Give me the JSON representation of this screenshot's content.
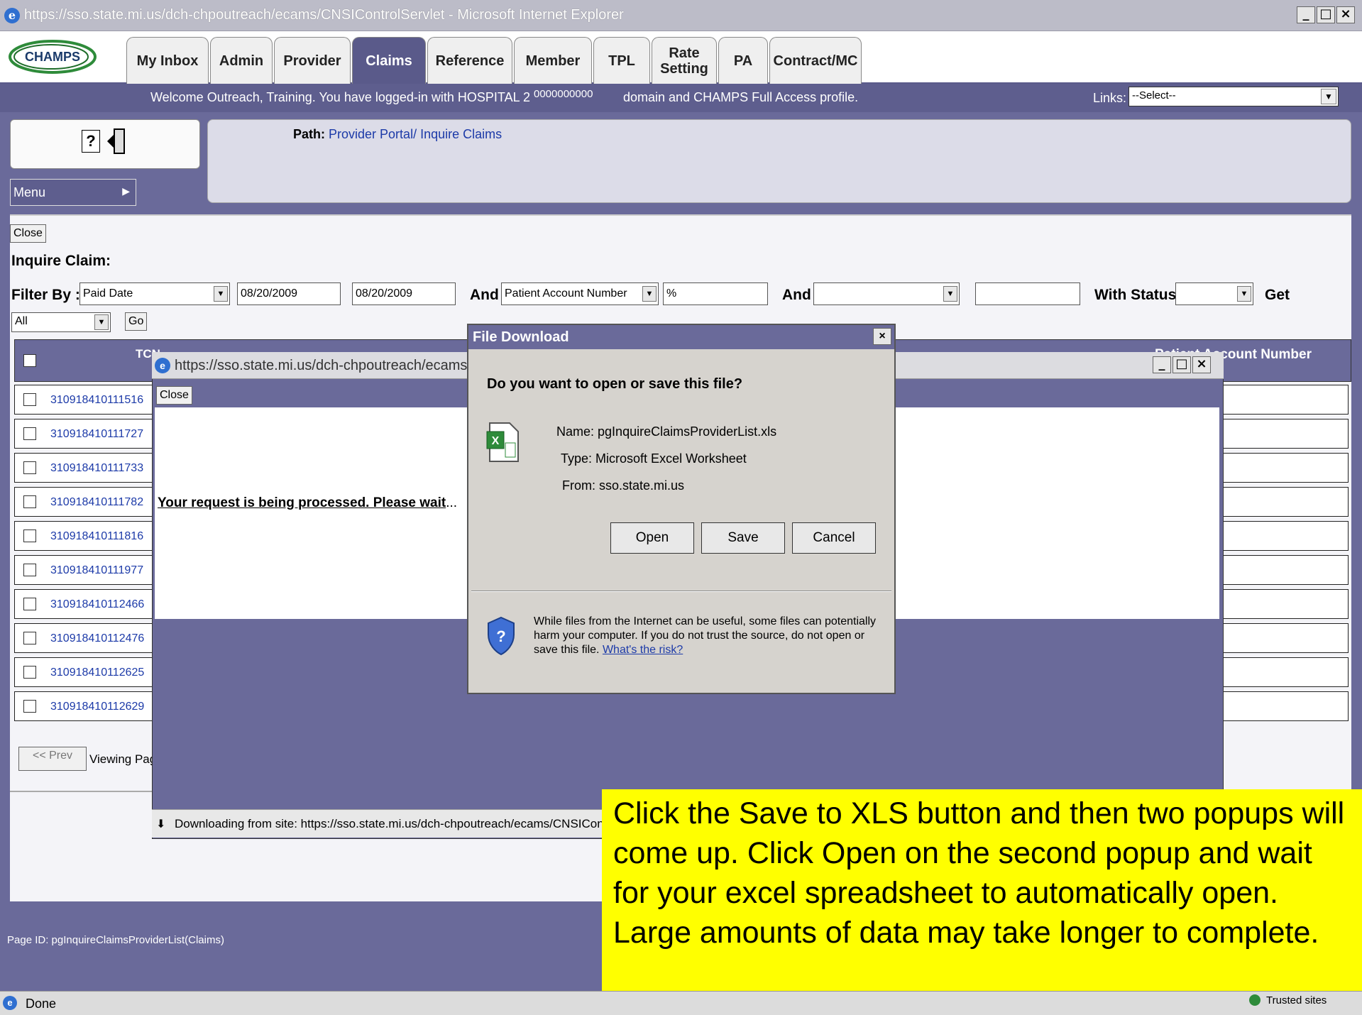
{
  "window": {
    "title": "https://sso.state.mi.us/dch-chpoutreach/ecams/CNSIControlServlet - Microsoft Internet Explorer"
  },
  "logo": "CHAMPS",
  "tabs": [
    {
      "label": "My Inbox"
    },
    {
      "label": "Admin"
    },
    {
      "label": "Provider"
    },
    {
      "label": "Claims"
    },
    {
      "label": "Reference"
    },
    {
      "label": "Member"
    },
    {
      "label": "TPL"
    },
    {
      "label": "Rate Setting"
    },
    {
      "label": "PA"
    },
    {
      "label": "Contract/MC"
    }
  ],
  "welcome": {
    "message": "Welcome Outreach, Training. You have logged-in with HOSPITAL 2",
    "account": "0000000000",
    "message_end": "domain and CHAMPS Full Access profile.",
    "links_label": "Links:",
    "links_value": "--Select--"
  },
  "menu_label": "Menu",
  "path": {
    "label": "Path:",
    "provider_portal": "Provider Portal/",
    "inquire_claims": "Inquire Claims"
  },
  "close_label": "Close",
  "page_heading": "Inquire Claim:",
  "filter": {
    "label": "Filter By :",
    "type": "Paid Date",
    "from": "08/20/2009",
    "to": "08/20/2009",
    "and1": "And",
    "field2": "Patient Account Number",
    "field2_value": "%",
    "and2": "And",
    "with_status": "With Status",
    "get": "Get",
    "show": "All",
    "go": "Go"
  },
  "table": {
    "col_tcn": "TCN",
    "col_patient": "Patient Account Number",
    "rows": [
      "310918410111516",
      "310918410111727",
      "310918410111733",
      "310918410111782",
      "310918410111816",
      "310918410111977",
      "310918410112466",
      "310918410112476",
      "310918410112625",
      "310918410112629"
    ]
  },
  "pager": {
    "prev": "<< Prev",
    "viewing": "Viewing Pag"
  },
  "page_id": "Page ID: pgInquireClaimsProviderList(Claims)",
  "proc_window": {
    "title": "https://sso.state.mi.us/dch-chpoutreach/ecams",
    "close": "Close",
    "message": "Your request is being processed. Please wait",
    "ellipsis": "...",
    "status": "Downloading from site: https://sso.state.mi.us/dch-chpoutreach/ecams/CNSIContro"
  },
  "dialog": {
    "title": "File Download",
    "question": "Do you want to open or save this file?",
    "name_label": "Name:",
    "name_value": "pgInquireClaimsProviderList.xls",
    "type_label": "Type:",
    "type_value": "Microsoft Excel Worksheet",
    "from_label": "From:",
    "from_value": "sso.state.mi.us",
    "open": "Open",
    "save": "Save",
    "cancel": "Cancel",
    "warning": "While files from the Internet can be useful, some files can potentially harm your computer. If you do not trust the source, do not open or save this file.",
    "risk_link": "What's the risk?"
  },
  "callout": "Click the Save to XLS button and then two popups will come up.  Click Open on the second popup and wait for your excel spreadsheet to automatically open.  Large amounts of data may take longer to complete.",
  "statusbar": {
    "left": "Done",
    "zone": "Trusted sites"
  }
}
